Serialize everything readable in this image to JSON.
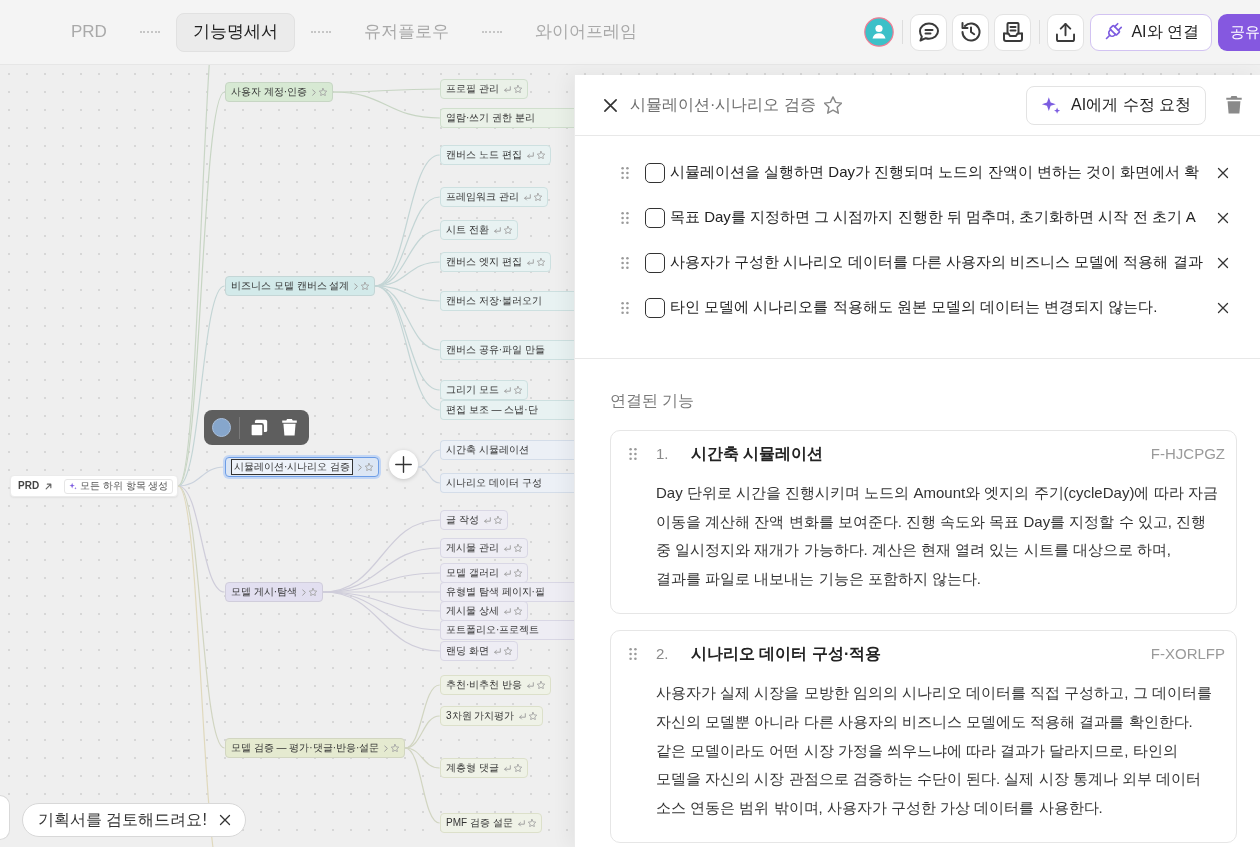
{
  "doc_tabs": [
    {
      "label": "PRD",
      "selected": false
    },
    {
      "label": "기능명세서",
      "selected": true
    },
    {
      "label": "유저플로우",
      "selected": false
    },
    {
      "label": "와이어프레임",
      "selected": false
    }
  ],
  "header_actions": {
    "connect_button": "AI와 연결",
    "share_button": "공유"
  },
  "mind_map": {
    "root": {
      "label": "PRD",
      "action": "모든 하위 항목 생성"
    },
    "branches": [
      {
        "label": "사용자 계정·인증",
        "color": "#d7e9d3",
        "selected": false,
        "children": [
          {
            "label": "프로필 관리",
            "selected": false,
            "cut_off": false
          },
          {
            "label": "열람·쓰기 권한 분리",
            "selected": false,
            "cut_off": true
          }
        ]
      },
      {
        "label": "비즈니스 모델 캔버스 설계",
        "color": "#d3eaea",
        "selected": false,
        "children": [
          {
            "label": "캔버스 노드 편집",
            "selected": false,
            "cut_off": false
          },
          {
            "label": "프레임워크 관리",
            "selected": false,
            "cut_off": false
          },
          {
            "label": "시트 전환",
            "selected": false,
            "cut_off": false
          },
          {
            "label": "캔버스 엣지 편집",
            "selected": false,
            "cut_off": false
          },
          {
            "label": "캔버스 저장·불러오기",
            "selected": false,
            "cut_off": true
          },
          {
            "label": "캔버스 공유·파일 만들",
            "selected": false,
            "cut_off": true
          },
          {
            "label": "그리기 모드",
            "selected": false,
            "cut_off": false
          },
          {
            "label": "편집 보조 — 스냅·단",
            "selected": false,
            "cut_off": true
          }
        ]
      },
      {
        "label": "시뮬레이션·시나리오 검증",
        "color": "#dce6f4",
        "selected": true,
        "children": [
          {
            "label": "시간축 시뮬레이션",
            "selected": false,
            "cut_off": true
          },
          {
            "label": "시나리오 데이터 구성",
            "selected": false,
            "cut_off": true
          }
        ]
      },
      {
        "label": "모델 게시·탐색",
        "color": "#e2dff0",
        "selected": false,
        "children": [
          {
            "label": "글 작성",
            "selected": false,
            "cut_off": false
          },
          {
            "label": "게시물 관리",
            "selected": false,
            "cut_off": false
          },
          {
            "label": "모델 갤러리",
            "selected": false,
            "cut_off": false
          },
          {
            "label": "유형별 탐색 페이지·필",
            "selected": false,
            "cut_off": true
          },
          {
            "label": "게시물 상세",
            "selected": false,
            "cut_off": false
          },
          {
            "label": "포트폴리오·프로젝트",
            "selected": false,
            "cut_off": true
          },
          {
            "label": "랜딩 화면",
            "selected": false,
            "cut_off": false
          }
        ]
      },
      {
        "label": "모델 검증 — 평가·댓글·반응·설문",
        "color": "#e5ead0",
        "selected": false,
        "children": [
          {
            "label": "추천·비추천 반응",
            "selected": false,
            "cut_off": false
          },
          {
            "label": "3차원 가치평가",
            "selected": false,
            "cut_off": false
          },
          {
            "label": "계층형 댓글",
            "selected": false,
            "cut_off": false
          },
          {
            "label": "PMF 검증 설문",
            "selected": false,
            "cut_off": false
          }
        ]
      }
    ]
  },
  "detail_panel": {
    "title": "시뮬레이션·시나리오 검증",
    "starred": false,
    "ai_button": "AI에게 수정 요청",
    "checklist": [
      {
        "text": "시뮬레이션을 실행하면 Day가 진행되며 노드의 잔액이 변하는 것이 화면에서 확",
        "checked": false
      },
      {
        "text": "목표 Day를 지정하면 그 시점까지 진행한 뒤 멈추며, 초기화하면 시작 전 초기 A",
        "checked": false
      },
      {
        "text": "사용자가 구성한 시나리오 데이터를 다른 사용자의 비즈니스 모델에 적용해 결과",
        "checked": false
      },
      {
        "text": "타인 모델에 시나리오를 적용해도 원본 모델의 데이터는 변경되지 않는다.",
        "checked": false
      }
    ],
    "linked_heading": "연결된 기능",
    "linked_features": [
      {
        "number": "1.",
        "title": "시간축 시뮬레이션",
        "code": "F-HJCPGZ",
        "description": "Day 단위로 시간을 진행시키며 노드의 Amount와 엣지의 주기(cycleDay)에 따라 자금 이동을 계산해 잔액 변화를 보여준다. 진행 속도와 목표 Day를 지정할 수 있고, 진행 중 일시정지와 재개가 가능하다. 계산은 현재 열려 있는 시트를 대상으로 하며, 결과를 파일로 내보내는 기능은 포함하지 않는다."
      },
      {
        "number": "2.",
        "title": "시나리오 데이터 구성·적용",
        "code": "F-XORLFP",
        "description": "사용자가 실제 시장을 모방한 임의의 시나리오 데이터를 직접 구성하고, 그 데이터를 자신의 모델뿐 아니라 다른 사용자의 비즈니스 모델에도 적용해 결과를 확인한다. 같은 모델이라도 어떤 시장 가정을 씌우느냐에 따라 결과가 달라지므로, 타인의 모델을 자신의 시장 관점으로 검증하는 수단이 된다. 실제 시장 통계나 외부 데이터 소스 연동은 범위 밖이며, 사용자가 구성한 가상 데이터를 사용한다."
      }
    ]
  },
  "toast": {
    "text": "기획서를 검토해드려요!"
  }
}
